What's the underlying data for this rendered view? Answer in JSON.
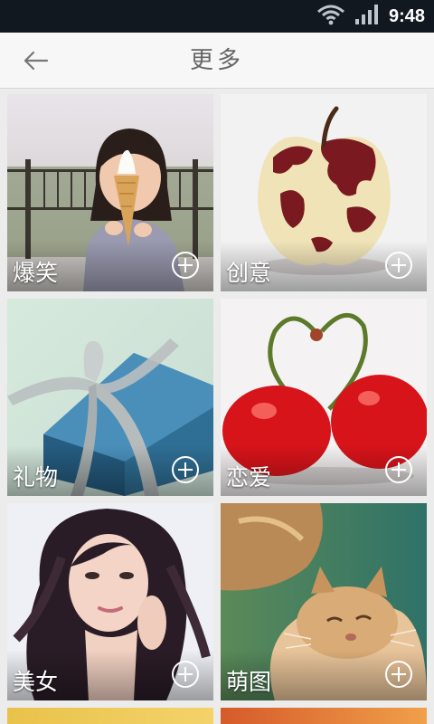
{
  "status_bar": {
    "time": "9:48",
    "icons": [
      "wifi-icon",
      "signal-icon"
    ]
  },
  "header": {
    "title": "更多",
    "back_icon": "arrow-left-icon"
  },
  "categories": [
    {
      "label": "爆笑",
      "action_icon": "add-circle-icon"
    },
    {
      "label": "创意",
      "action_icon": "add-circle-icon"
    },
    {
      "label": "礼物",
      "action_icon": "add-circle-icon"
    },
    {
      "label": "恋爱",
      "action_icon": "add-circle-icon"
    },
    {
      "label": "美女",
      "action_icon": "add-circle-icon"
    },
    {
      "label": "萌图",
      "action_icon": "add-circle-icon"
    }
  ],
  "colors": {
    "status_bar_bg": "#121820",
    "header_bg": "#f7f7f7",
    "page_bg": "#ececec",
    "title_text": "#666666"
  }
}
